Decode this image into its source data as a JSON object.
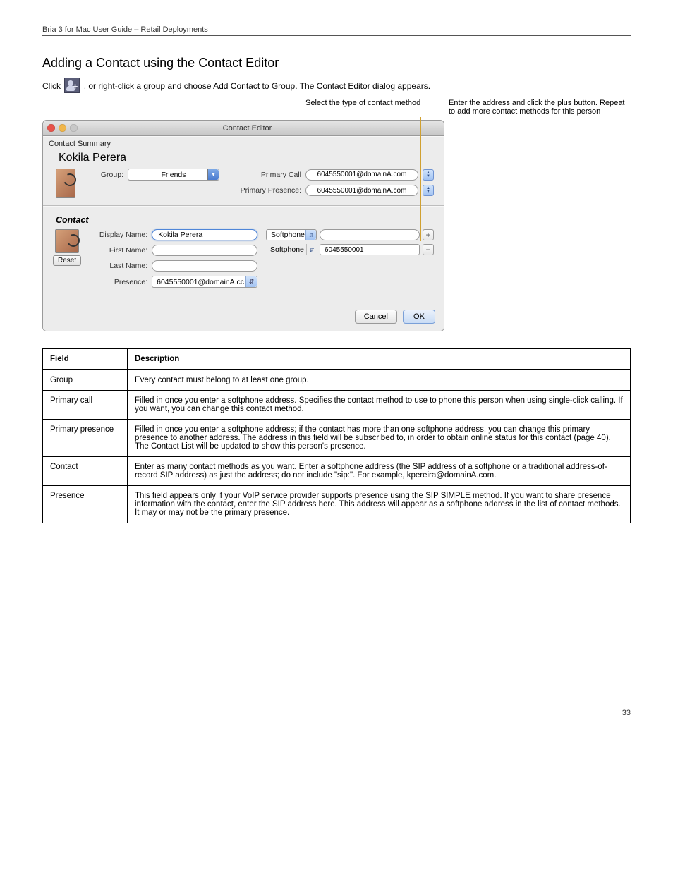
{
  "header": {
    "left": "Bria 3 for Mac User Guide – Retail Deployments",
    "right": ""
  },
  "section_title": "Adding a Contact using the Contact Editor",
  "para1_prefix": "Click ",
  "para1_suffix": ", or right-click a group and choose Add Contact to Group. The Contact Editor dialog appears.",
  "annot": {
    "a2": "Select the type of contact method",
    "a3": "Enter the address and click the plus button. Repeat to add more contact methods for this person"
  },
  "window": {
    "title": "Contact Editor",
    "tab": "Contact Summary",
    "name": "Kokila Perera",
    "group_label": "Group:",
    "group_value": "Friends",
    "primary_call_label": "Primary Call",
    "primary_call_value": "6045550001@domainA.com",
    "primary_presence_label": "Primary Presence:",
    "primary_presence_value": "6045550001@domainA.com",
    "contact_header": "Contact",
    "reset": "Reset",
    "display_name_label": "Display Name:",
    "display_name_value": "Kokila Perera",
    "first_name_label": "First Name:",
    "first_name_value": "",
    "last_name_label": "Last Name:",
    "last_name_value": "",
    "presence_label": "Presence:",
    "presence_value": "6045550001@domainA.cc...",
    "method_dd1": "Softphone",
    "method_field1": "",
    "method_dd2": "Softphone",
    "method_field2": "6045550001",
    "cancel": "Cancel",
    "ok": "OK"
  },
  "table": {
    "head": {
      "c1": "Field",
      "c2": "Description"
    },
    "rows": [
      {
        "c1": "Group",
        "c2": "Every contact must belong to at least one group."
      },
      {
        "c1": "Primary call",
        "c2": "Filled in once you enter a softphone address. Specifies the contact method to use to phone this person when using single-click calling. If you want, you can change this contact method."
      },
      {
        "c1": "Primary presence",
        "c2": "Filled in once you enter a softphone address; if the contact has more than one softphone address, you can change this primary presence to another address. The address in this field will be subscribed to, in order to obtain online status for this contact (page 40). The Contact List will be updated to show this person's presence."
      },
      {
        "c1": "Contact",
        "c2": "Enter as many contact methods as you want. Enter a softphone address (the SIP address of a softphone or a traditional address-of-record SIP address) as just the address; do not include \"sip:\".\n\nFor example, kpereira@domainA.com."
      },
      {
        "c1": "Presence",
        "c2": "This field appears only if your VoIP service provider supports presence using the SIP SIMPLE method.\n\nIf you want to share presence information with the contact, enter the SIP address here. This address will appear as a softphone address in the list of contact methods. It may or may not be the primary presence."
      }
    ]
  },
  "footer": {
    "left": "",
    "right": "33"
  }
}
